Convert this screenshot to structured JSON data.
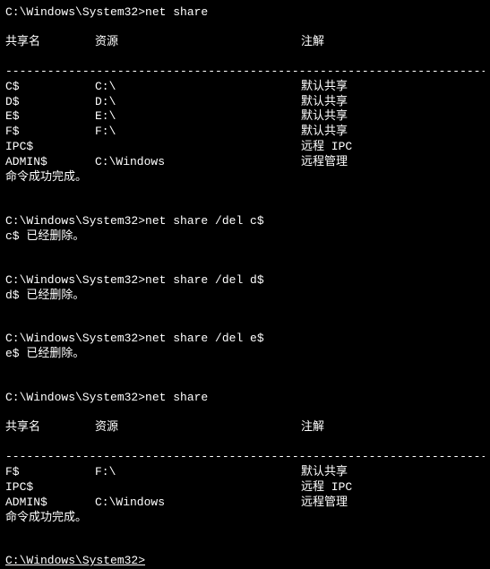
{
  "prompts": {
    "p0": "C:\\Windows\\System32>net share",
    "p1": "C:\\Windows\\System32>net share /del c$",
    "p2": "C:\\Windows\\System32>net share /del d$",
    "p3": "C:\\Windows\\System32>net share /del e$",
    "p4": "C:\\Windows\\System32>net share",
    "p5": "C:\\Windows\\System32>"
  },
  "headers": {
    "name": "共享名",
    "resource": "资源",
    "remark": "注解"
  },
  "divider": "-------------------------------------------------------------------------------",
  "shares1": [
    {
      "name": "C$",
      "resource": "C:\\",
      "remark": "默认共享"
    },
    {
      "name": "D$",
      "resource": "D:\\",
      "remark": "默认共享"
    },
    {
      "name": "E$",
      "resource": "E:\\",
      "remark": "默认共享"
    },
    {
      "name": "F$",
      "resource": "F:\\",
      "remark": "默认共享"
    },
    {
      "name": "IPC$",
      "resource": "",
      "remark": "远程 IPC"
    },
    {
      "name": "ADMIN$",
      "resource": "C:\\Windows",
      "remark": "远程管理"
    }
  ],
  "shares2": [
    {
      "name": "F$",
      "resource": "F:\\",
      "remark": "默认共享"
    },
    {
      "name": "IPC$",
      "resource": "",
      "remark": "远程 IPC"
    },
    {
      "name": "ADMIN$",
      "resource": "C:\\Windows",
      "remark": "远程管理"
    }
  ],
  "success": "命令成功完成。",
  "deleted": {
    "c": "c$ 已经删除。",
    "d": "d$ 已经删除。",
    "e": "e$ 已经删除。"
  }
}
